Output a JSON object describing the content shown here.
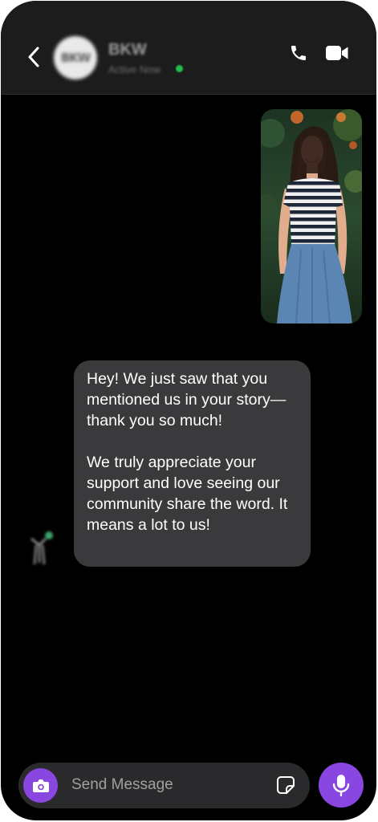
{
  "header": {
    "back_icon": "chevron-left-icon",
    "avatar_text": "BKW",
    "contact_name": "BKW",
    "status": "Active Now",
    "status_color": "#1fbf50",
    "call_icon": "phone-icon",
    "video_icon": "video-camera-icon"
  },
  "messages": {
    "photo": {
      "icon": "photo-thumbnail"
    },
    "bubble": {
      "paragraph_1": "Hey! We just saw that you mentioned us in your story—thank you so much!",
      "paragraph_2": "We truly appreciate your support and love seeing our community share the word. It means a lot to us!"
    }
  },
  "composer": {
    "camera_icon": "camera-icon",
    "placeholder": "Send Message",
    "value": "",
    "sticker_icon": "sticker-icon",
    "mic_icon": "microphone-icon"
  },
  "colors": {
    "background": "#000000",
    "header": "#1c1c1c",
    "bubble": "#3a3a3c",
    "composer": "#2a2a2c",
    "accent": "#8a46e0"
  }
}
